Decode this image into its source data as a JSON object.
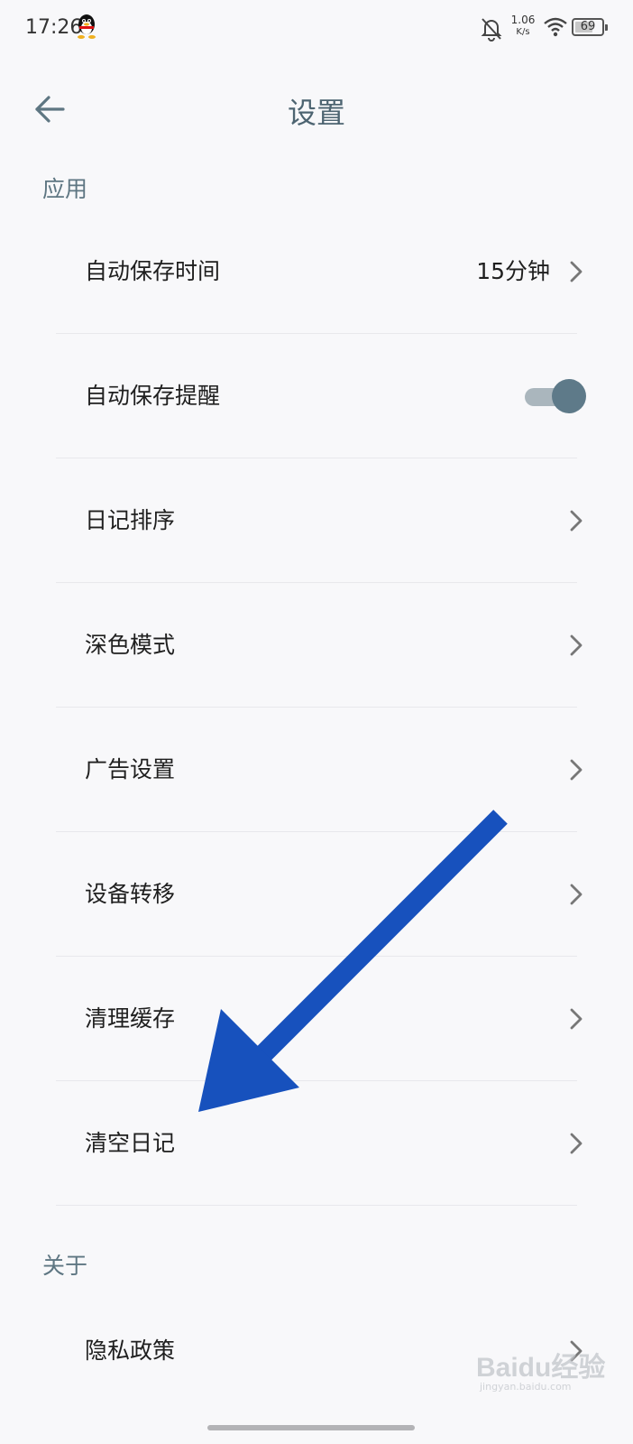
{
  "status_bar": {
    "time": "17:26",
    "net_speed_value": "1.06",
    "net_speed_unit": "K/s",
    "battery": "69",
    "battery_level": 0.69,
    "icons": [
      "qq-icon",
      "bell-off-icon",
      "wifi-icon",
      "battery-icon"
    ]
  },
  "header": {
    "title": "设置",
    "back_icon": "arrow-left-icon"
  },
  "sections": {
    "app": {
      "title": "应用",
      "items": [
        {
          "label": "自动保存时间",
          "value": "15分钟",
          "control": "chevron"
        },
        {
          "label": "自动保存提醒",
          "control": "toggle",
          "toggle_on": true
        },
        {
          "label": "日记排序",
          "control": "chevron"
        },
        {
          "label": "深色模式",
          "control": "chevron"
        },
        {
          "label": "广告设置",
          "control": "chevron"
        },
        {
          "label": "设备转移",
          "control": "chevron"
        },
        {
          "label": "清理缓存",
          "control": "chevron"
        },
        {
          "label": "清空日记",
          "control": "chevron"
        }
      ]
    },
    "about": {
      "title": "关于",
      "items": [
        {
          "label": "隐私政策",
          "control": "chevron"
        }
      ]
    }
  },
  "overlay": {
    "arrow_color": "#1751bd"
  },
  "watermark": {
    "brand": "Baidu经验",
    "site": "jingyan.baidu.com"
  },
  "colors": {
    "background": "#f8f8fa",
    "accent": "#5e7a89",
    "title": "#4d6471"
  }
}
